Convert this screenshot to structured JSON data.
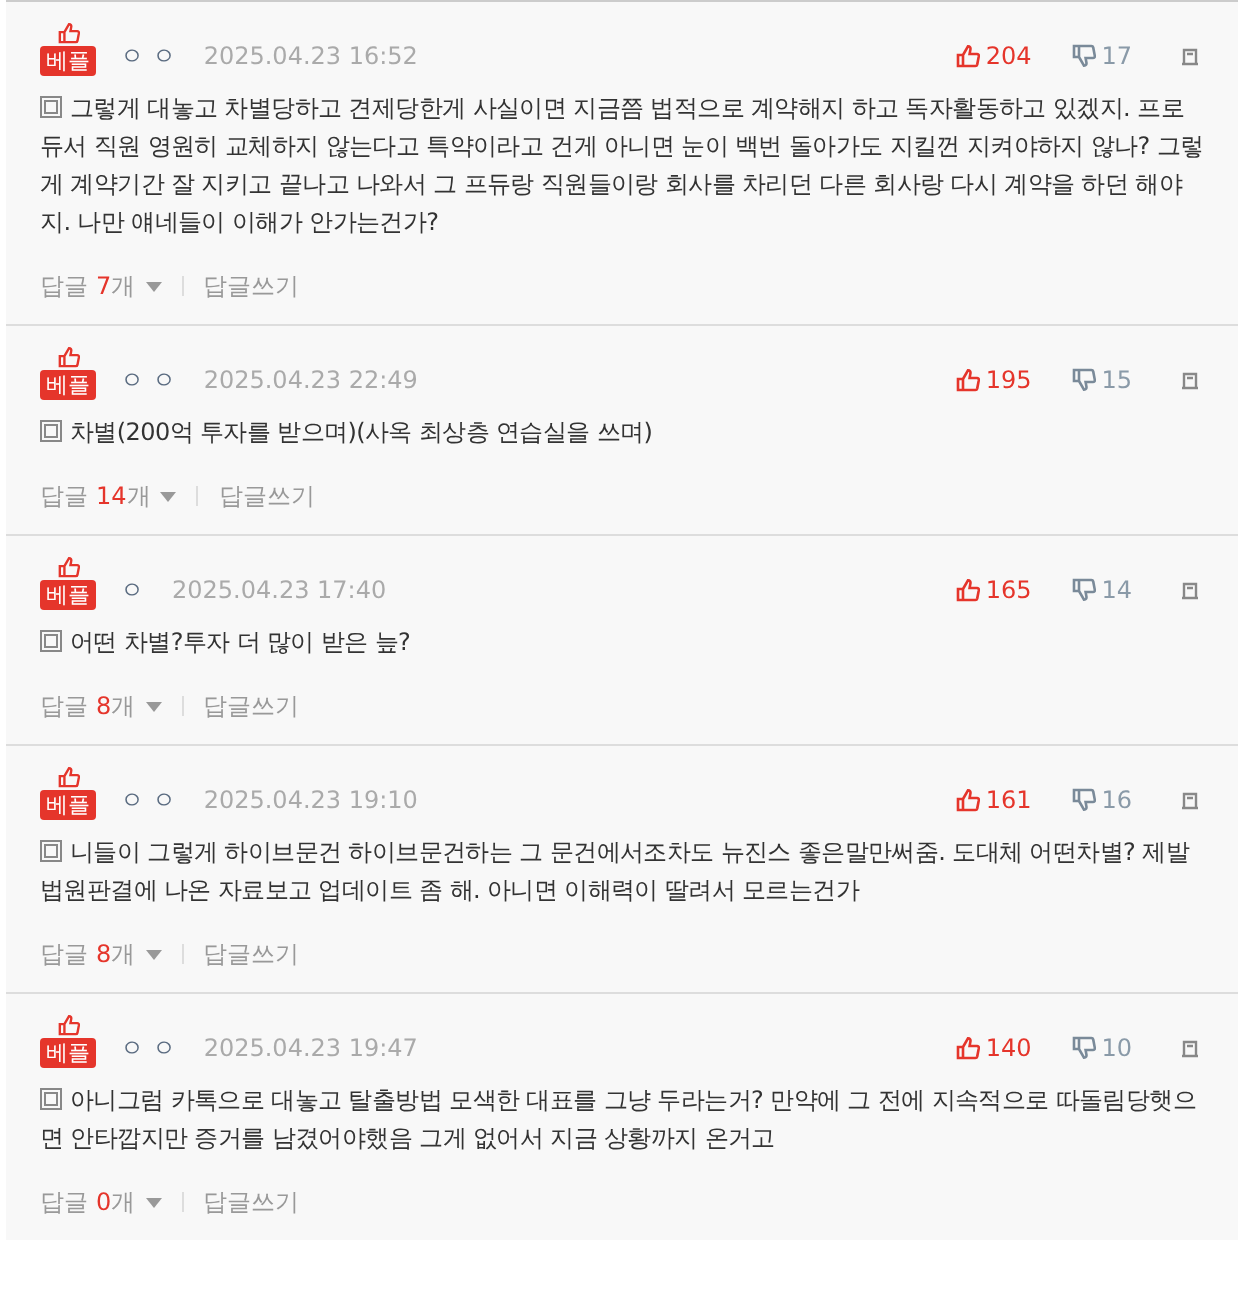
{
  "comments": [
    {
      "badge": "베플",
      "author": "ㅇ ㅇ",
      "date": "2025.04.23 16:52",
      "likes": "204",
      "dislikes": "17",
      "text": "그렇게 대놓고 차별당하고 견제당한게 사실이면 지금쯤 법적으로 계약해지 하고 독자활동하고 있겠지. 프로듀서 직원 영원히 교체하지 않는다고 특약이라고 건게 아니면 눈이 백번 돌아가도 지킬껀 지켜야하지 않나? 그렇게 계약기간 잘 지키고 끝나고 나와서 그 프듀랑 직원들이랑 회사를 차리던 다른 회사랑 다시 계약을 하던 해야지. 나만 얘네들이 이해가 안가는건가?",
      "replies": {
        "label": "답글",
        "count": "7",
        "unit": "개"
      },
      "write_reply": "답글쓰기"
    },
    {
      "badge": "베플",
      "author": "ㅇ ㅇ",
      "date": "2025.04.23 22:49",
      "likes": "195",
      "dislikes": "15",
      "text": "차별(200억 투자를 받으며)(사옥 최상층 연습실을 쓰며)",
      "replies": {
        "label": "답글",
        "count": "14",
        "unit": "개"
      },
      "write_reply": "답글쓰기"
    },
    {
      "badge": "베플",
      "author": "ㅇ",
      "date": "2025.04.23 17:40",
      "likes": "165",
      "dislikes": "14",
      "text": "어떤 차별?투자 더 많이 받은 늪?",
      "replies": {
        "label": "답글",
        "count": "8",
        "unit": "개"
      },
      "write_reply": "답글쓰기"
    },
    {
      "badge": "베플",
      "author": "ㅇ ㅇ",
      "date": "2025.04.23 19:10",
      "likes": "161",
      "dislikes": "16",
      "text": "니들이 그렇게 하이브문건 하이브문건하는 그 문건에서조차도 뉴진스 좋은말만써줌. 도대체 어떤차별? 제발 법원판결에 나온 자료보고 업데이트 좀 해. 아니면 이해력이 딸려서 모르는건가",
      "replies": {
        "label": "답글",
        "count": "8",
        "unit": "개"
      },
      "write_reply": "답글쓰기"
    },
    {
      "badge": "베플",
      "author": "ㅇ ㅇ",
      "date": "2025.04.23 19:47",
      "likes": "140",
      "dislikes": "10",
      "text": "아니그럼 카톡으로 대놓고 탈출방법 모색한 대표를 그냥 두라는거? 만약에 그 전에 지속적으로 따돌림당햇으면 안타깝지만 증거를 남겼어야했음 그게 없어서 지금 상황까지 온거고",
      "replies": {
        "label": "답글",
        "count": "0",
        "unit": "개"
      },
      "write_reply": "답글쓰기"
    }
  ]
}
